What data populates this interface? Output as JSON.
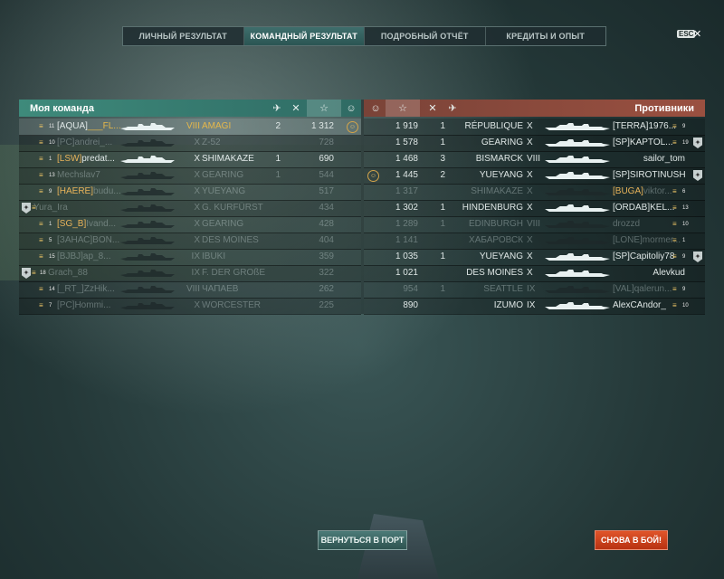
{
  "tabs": [
    "ЛИЧНЫЙ РЕЗУЛЬТАТ",
    "КОМАНДНЫЙ РЕЗУЛЬТАТ",
    "ПОДРОБНЫЙ ОТЧЁТ",
    "КРЕДИТЫ И ОПЫТ"
  ],
  "active_tab": 1,
  "esc_label": "ESC",
  "header": {
    "my_team": "Моя команда",
    "enemies": "Противники"
  },
  "colors": {
    "my_header": "#3e8a7b",
    "enemy_header": "#9a5040",
    "gold": "#e6b84a",
    "battle_button": "#e0552a"
  },
  "my_team": [
    {
      "rank": "11",
      "clan": "[AQUA]",
      "name": "___FL...",
      "tier": "VIII",
      "ship": "AMAGI",
      "kills": "2",
      "xp": "1 312",
      "medal": true,
      "hl": true,
      "gold": true
    },
    {
      "rank": "10",
      "clan": "[PC]",
      "name": "andrei_...",
      "tier": "X",
      "ship": "Z-52",
      "kills": "",
      "xp": "728",
      "alive": false
    },
    {
      "rank": "1",
      "clan": "[LSW]",
      "name": "predat...",
      "tier": "X",
      "ship": "SHIMAKAZE",
      "kills": "1",
      "xp": "690",
      "alive": true,
      "clan_gold": true
    },
    {
      "rank": "13",
      "clan": "",
      "name": "Mechslav7",
      "tier": "X",
      "ship": "GEARING",
      "kills": "1",
      "xp": "544",
      "alive": false
    },
    {
      "rank": "9",
      "clan": "[HAERE]",
      "name": "budu...",
      "tier": "X",
      "ship": "YUEYANG",
      "kills": "",
      "xp": "517",
      "alive": false,
      "clan_gold": true
    },
    {
      "rank": "",
      "clan": "",
      "name": "Yura_Ira",
      "tier": "X",
      "ship": "G. KURFÜRST",
      "kills": "",
      "xp": "434",
      "alive": false,
      "badge": true
    },
    {
      "rank": "1",
      "clan": "[SG_B]",
      "name": "Ivand...",
      "tier": "X",
      "ship": "GEARING",
      "kills": "",
      "xp": "428",
      "alive": false,
      "clan_gold": true
    },
    {
      "rank": "5",
      "clan": "[ЗАНАС]",
      "name": "BON...",
      "tier": "X",
      "ship": "DES MOINES",
      "kills": "",
      "xp": "404",
      "alive": false
    },
    {
      "rank": "15",
      "clan": "[BJBJ]",
      "name": "ap_8...",
      "tier": "IX",
      "ship": "IBUKI",
      "kills": "",
      "xp": "359",
      "alive": false
    },
    {
      "rank": "18",
      "clan": "",
      "name": "Grach_88",
      "tier": "IX",
      "ship": "F. DER GROßE",
      "kills": "",
      "xp": "322",
      "alive": false,
      "badge": true
    },
    {
      "rank": "14",
      "clan": "[_RT_]",
      "name": "ZzHik...",
      "tier": "VIII",
      "ship": "ЧАПАЕВ",
      "kills": "",
      "xp": "262",
      "alive": false
    },
    {
      "rank": "7",
      "clan": "[PC]",
      "name": "Hommi...",
      "tier": "X",
      "ship": "WORCESTER",
      "kills": "",
      "xp": "225",
      "alive": false
    }
  ],
  "enemy_team": [
    {
      "xp": "1 919",
      "kills": "1",
      "ship": "RÉPUBLIQUE",
      "tier": "X",
      "clan": "[TERRA]",
      "name": "1976...",
      "rank": "9",
      "alive": true
    },
    {
      "xp": "1 578",
      "kills": "1",
      "ship": "GEARING",
      "tier": "X",
      "clan": "[SP]",
      "name": "KAPTOL...",
      "rank": "19",
      "alive": true,
      "badge": true
    },
    {
      "xp": "1 468",
      "kills": "3",
      "ship": "BISMARCK",
      "tier": "VIII",
      "clan": "",
      "name": "sailor_tom",
      "rank": "",
      "alive": true
    },
    {
      "xp": "1 445",
      "kills": "2",
      "ship": "YUEYANG",
      "tier": "X",
      "clan": "[SP]",
      "name": "SIROTINUSHK...",
      "rank": "",
      "alive": true,
      "badge": true,
      "medal": true
    },
    {
      "xp": "1 317",
      "kills": "",
      "ship": "SHIMAKAZE",
      "tier": "X",
      "clan": "[BUGA]",
      "name": "viktor...",
      "rank": "6",
      "alive": false,
      "clan_gold": true
    },
    {
      "xp": "1 302",
      "kills": "1",
      "ship": "HINDENBURG",
      "tier": "X",
      "clan": "[ORDAB]",
      "name": "KEL...",
      "rank": "13",
      "alive": true
    },
    {
      "xp": "1 289",
      "kills": "1",
      "ship": "EDINBURGH",
      "tier": "VIII",
      "clan": "",
      "name": "drozzd",
      "rank": "10",
      "alive": false
    },
    {
      "xp": "1 141",
      "kills": "",
      "ship": "ХАБАРОВСК",
      "tier": "X",
      "clan": "[LONE]",
      "name": "mormer...",
      "rank": "1",
      "alive": false
    },
    {
      "xp": "1 035",
      "kills": "1",
      "ship": "YUEYANG",
      "tier": "X",
      "clan": "[SP]",
      "name": "Capitoliy78",
      "rank": "9",
      "alive": true,
      "badge": true
    },
    {
      "xp": "1 021",
      "kills": "",
      "ship": "DES MOINES",
      "tier": "X",
      "clan": "",
      "name": "Alevkud",
      "rank": "",
      "alive": true
    },
    {
      "xp": "954",
      "kills": "1",
      "ship": "SEATTLE",
      "tier": "IX",
      "clan": "[VAL]",
      "name": "qalerun...",
      "rank": "9",
      "alive": false
    },
    {
      "xp": "890",
      "kills": "",
      "ship": "IZUMO",
      "tier": "IX",
      "clan": "",
      "name": "AlexCAndor_",
      "rank": "10",
      "alive": true
    }
  ],
  "buttons": {
    "port": "ВЕРНУТЬСЯ В ПОРТ",
    "battle": "СНОВА В БОЙ!"
  }
}
